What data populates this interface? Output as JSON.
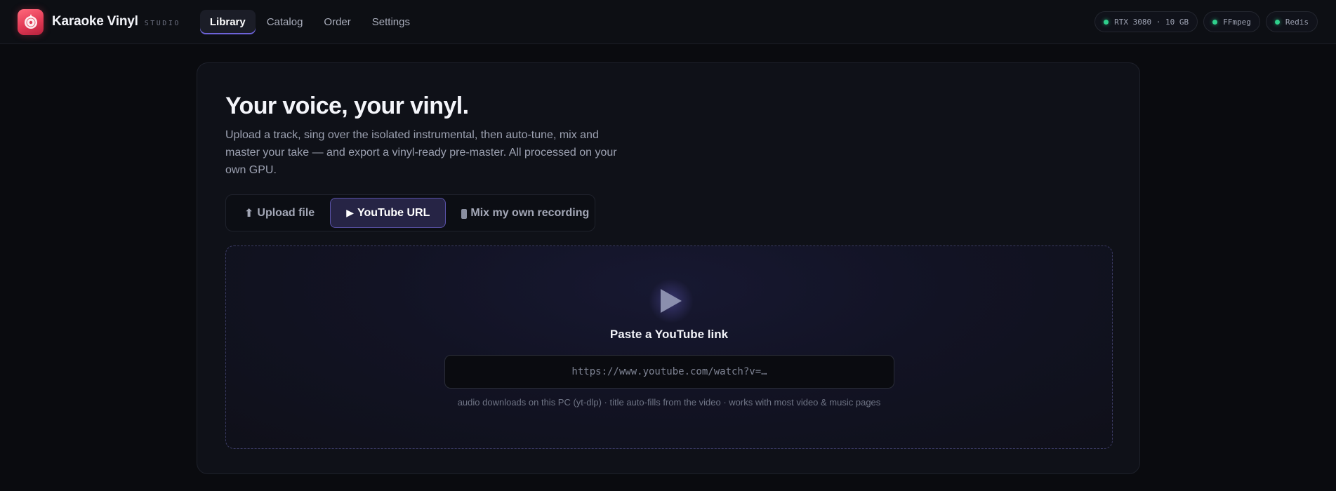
{
  "app": {
    "name": "Karaoke Vinyl",
    "subtitle": "STUDIO",
    "logo_icon": "vinyl-record-logo-icon",
    "accent_color": "#6d63d8",
    "brand_color": "#e23a55"
  },
  "nav": {
    "items": [
      {
        "label": "Library",
        "active": true
      },
      {
        "label": "Catalog",
        "active": false
      },
      {
        "label": "Order",
        "active": false
      },
      {
        "label": "Settings",
        "active": false
      }
    ]
  },
  "status": {
    "items": [
      {
        "label": "RTX 3080 · 10 GB",
        "state": "ok",
        "color": "#2fd08c"
      },
      {
        "label": "FFmpeg",
        "state": "ok",
        "color": "#2fd08c"
      },
      {
        "label": "Redis",
        "state": "ok",
        "color": "#2fd08c"
      }
    ]
  },
  "hero": {
    "title": "Your voice, your vinyl.",
    "description": "Upload a track, sing over the isolated instrumental, then auto-tune, mix and master your take — and export a vinyl-ready pre-master. All processed on your own GPU."
  },
  "source_tabs": {
    "items": [
      {
        "icon": "⬆",
        "icon_name": "upload-arrow-icon",
        "label": "Upload file",
        "active": false
      },
      {
        "icon": "▶",
        "icon_name": "play-icon",
        "label": "YouTube URL",
        "active": true
      },
      {
        "icon": "",
        "icon_name": "phone-icon",
        "label": "Mix my own recording",
        "active": false
      }
    ]
  },
  "youtube": {
    "icon": "play-triangle-icon",
    "title": "Paste a YouTube link",
    "input_value": "",
    "input_placeholder": "https://www.youtube.com/watch?v=…",
    "hint": "audio downloads on this PC (yt-dlp) · title auto-fills from the video · works with most video & music pages"
  }
}
